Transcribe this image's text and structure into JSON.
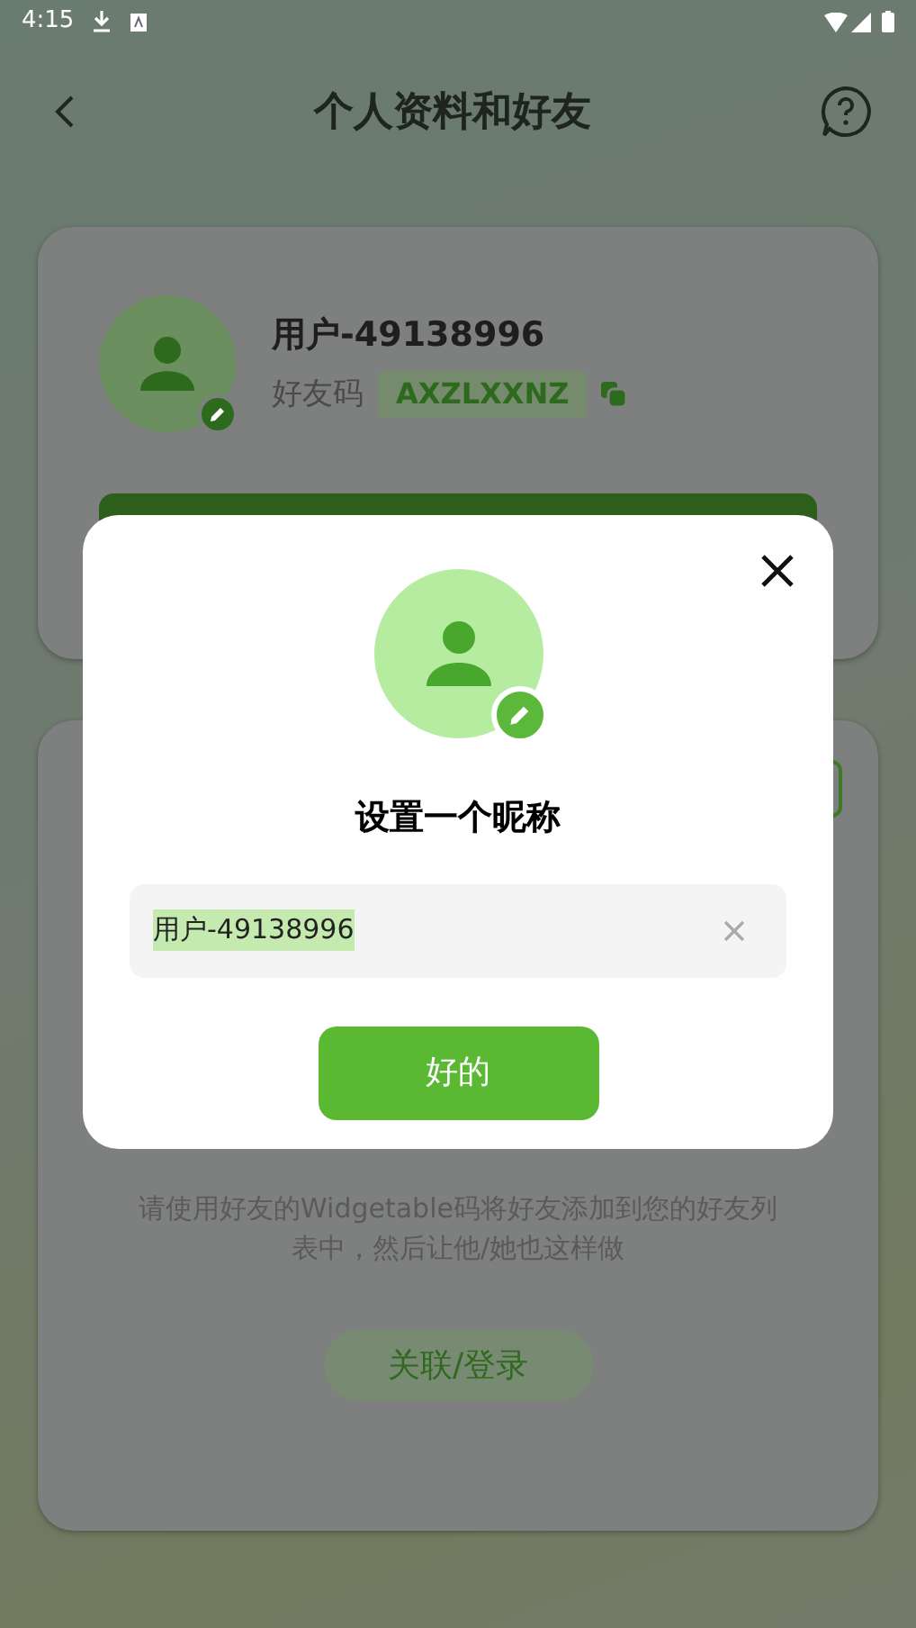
{
  "status_bar": {
    "time": "4:15"
  },
  "header": {
    "title": "个人资料和好友"
  },
  "profile": {
    "name": "用户-49138996",
    "friend_code_label": "好友码",
    "friend_code": "AXZLXXNZ"
  },
  "friends": {
    "hint": "请使用好友的Widgetable码将好友添加到您的好友列表中，然后让他/她也这样做",
    "link_button": "关联/登录"
  },
  "dialog": {
    "title": "设置一个昵称",
    "nickname_field": {
      "value": "用户-49138996",
      "selected": true
    },
    "ok_button": "好的"
  }
}
